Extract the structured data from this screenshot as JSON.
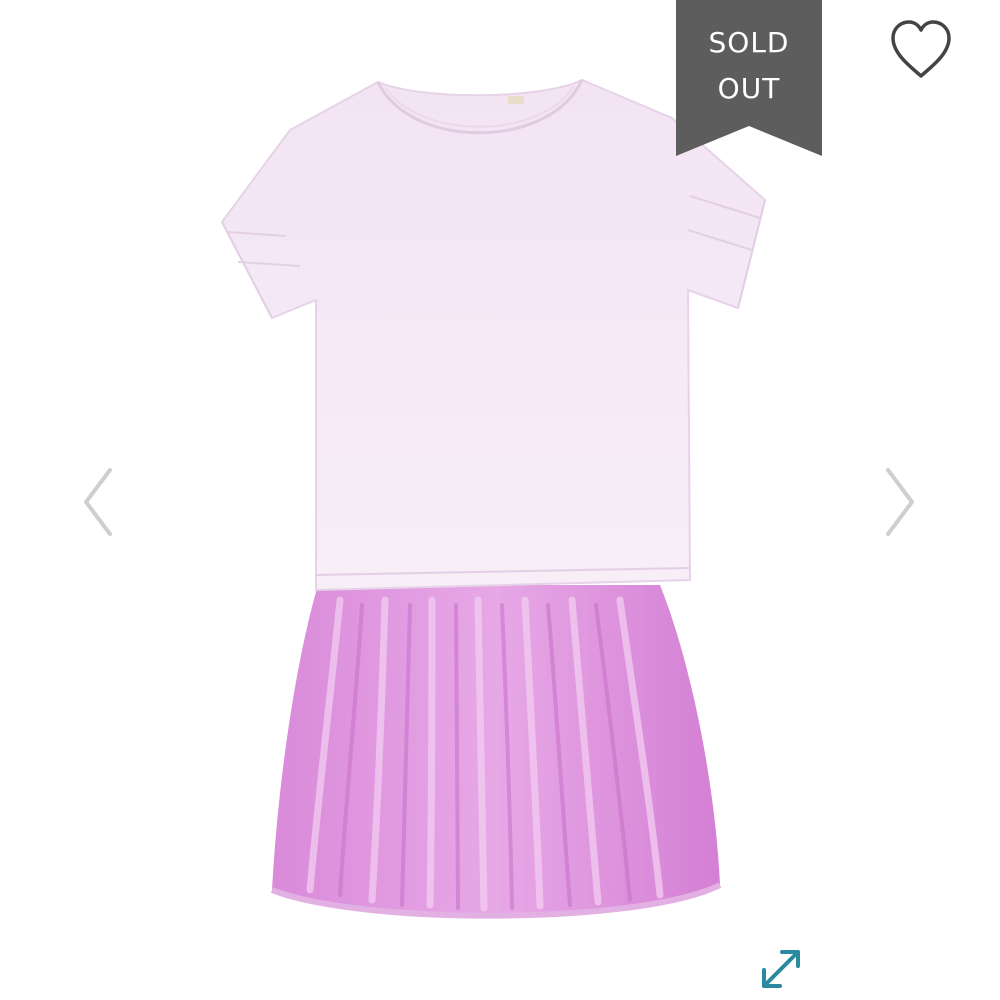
{
  "badge": {
    "line1": "SOLD",
    "line2": "OUT",
    "background": "#5d5d5d",
    "text_color": "#ffffff"
  },
  "icons": {
    "wishlist": "heart-outline-icon",
    "previous": "chevron-left-icon",
    "next": "chevron-right-icon",
    "zoom": "expand-arrows-icon"
  },
  "colors": {
    "shirt": "#f5e9f6",
    "skirt": "#d884d8",
    "arrow": "#cfcfcf",
    "heart": "#444444",
    "zoom": "#2a8aa0"
  }
}
